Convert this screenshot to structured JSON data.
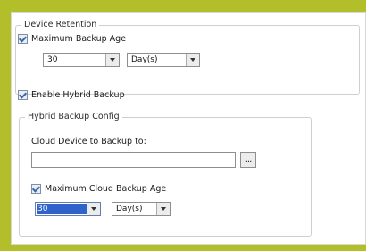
{
  "device_retention": {
    "title": "Device Retention",
    "max_backup_age_label": "Maximum Backup Age",
    "max_backup_age_checked": true,
    "age_value": "30",
    "age_unit": "Day(s)"
  },
  "hybrid_backup": {
    "enable_label": "Enable Hybrid Backup",
    "enabled": true
  },
  "hybrid_backup_config": {
    "title": "Hybrid Backup Config",
    "cloud_device_label": "Cloud Device to Backup to:",
    "cloud_device_value": "",
    "browse_label": "...",
    "max_cloud_age_label": "Maximum Cloud Backup Age",
    "max_cloud_age_checked": true,
    "cloud_age_value": "30",
    "cloud_age_unit": "Day(s)"
  },
  "icons": {
    "dropdown": "chevron-down-icon",
    "checkbox": "checkbox-icon"
  }
}
